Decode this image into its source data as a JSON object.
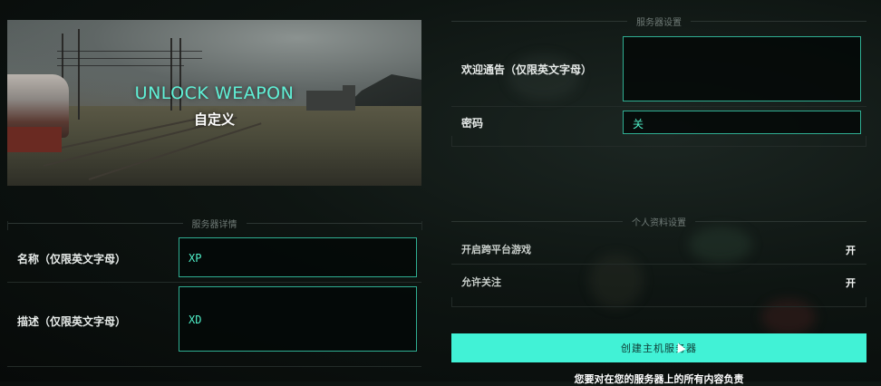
{
  "banner": {
    "title": "UNLOCK WEAPON",
    "subtitle": "自定义"
  },
  "server_details": {
    "header": "服务器详情",
    "name_label": "名称（仅限英文字母）",
    "name_value": "XP",
    "desc_label": "描述（仅限英文字母）",
    "desc_value": "XD"
  },
  "server_settings": {
    "header": "服务器设置",
    "welcome_label": "欢迎通告（仅限英文字母）",
    "welcome_value": "",
    "password_label": "密码",
    "password_value": "关"
  },
  "profile_settings": {
    "header": "个人资料设置",
    "crossplay_label": "开启跨平台游戏",
    "crossplay_value": "开",
    "follow_label": "允许关注",
    "follow_value": "开"
  },
  "actions": {
    "create_label": "创建主机服务器",
    "footnote": "您要对在您的服务器上的所有内容负责"
  },
  "colors": {
    "accent": "#41f2d6",
    "field_border": "#2fae92",
    "field_text": "#4ff0c8"
  }
}
